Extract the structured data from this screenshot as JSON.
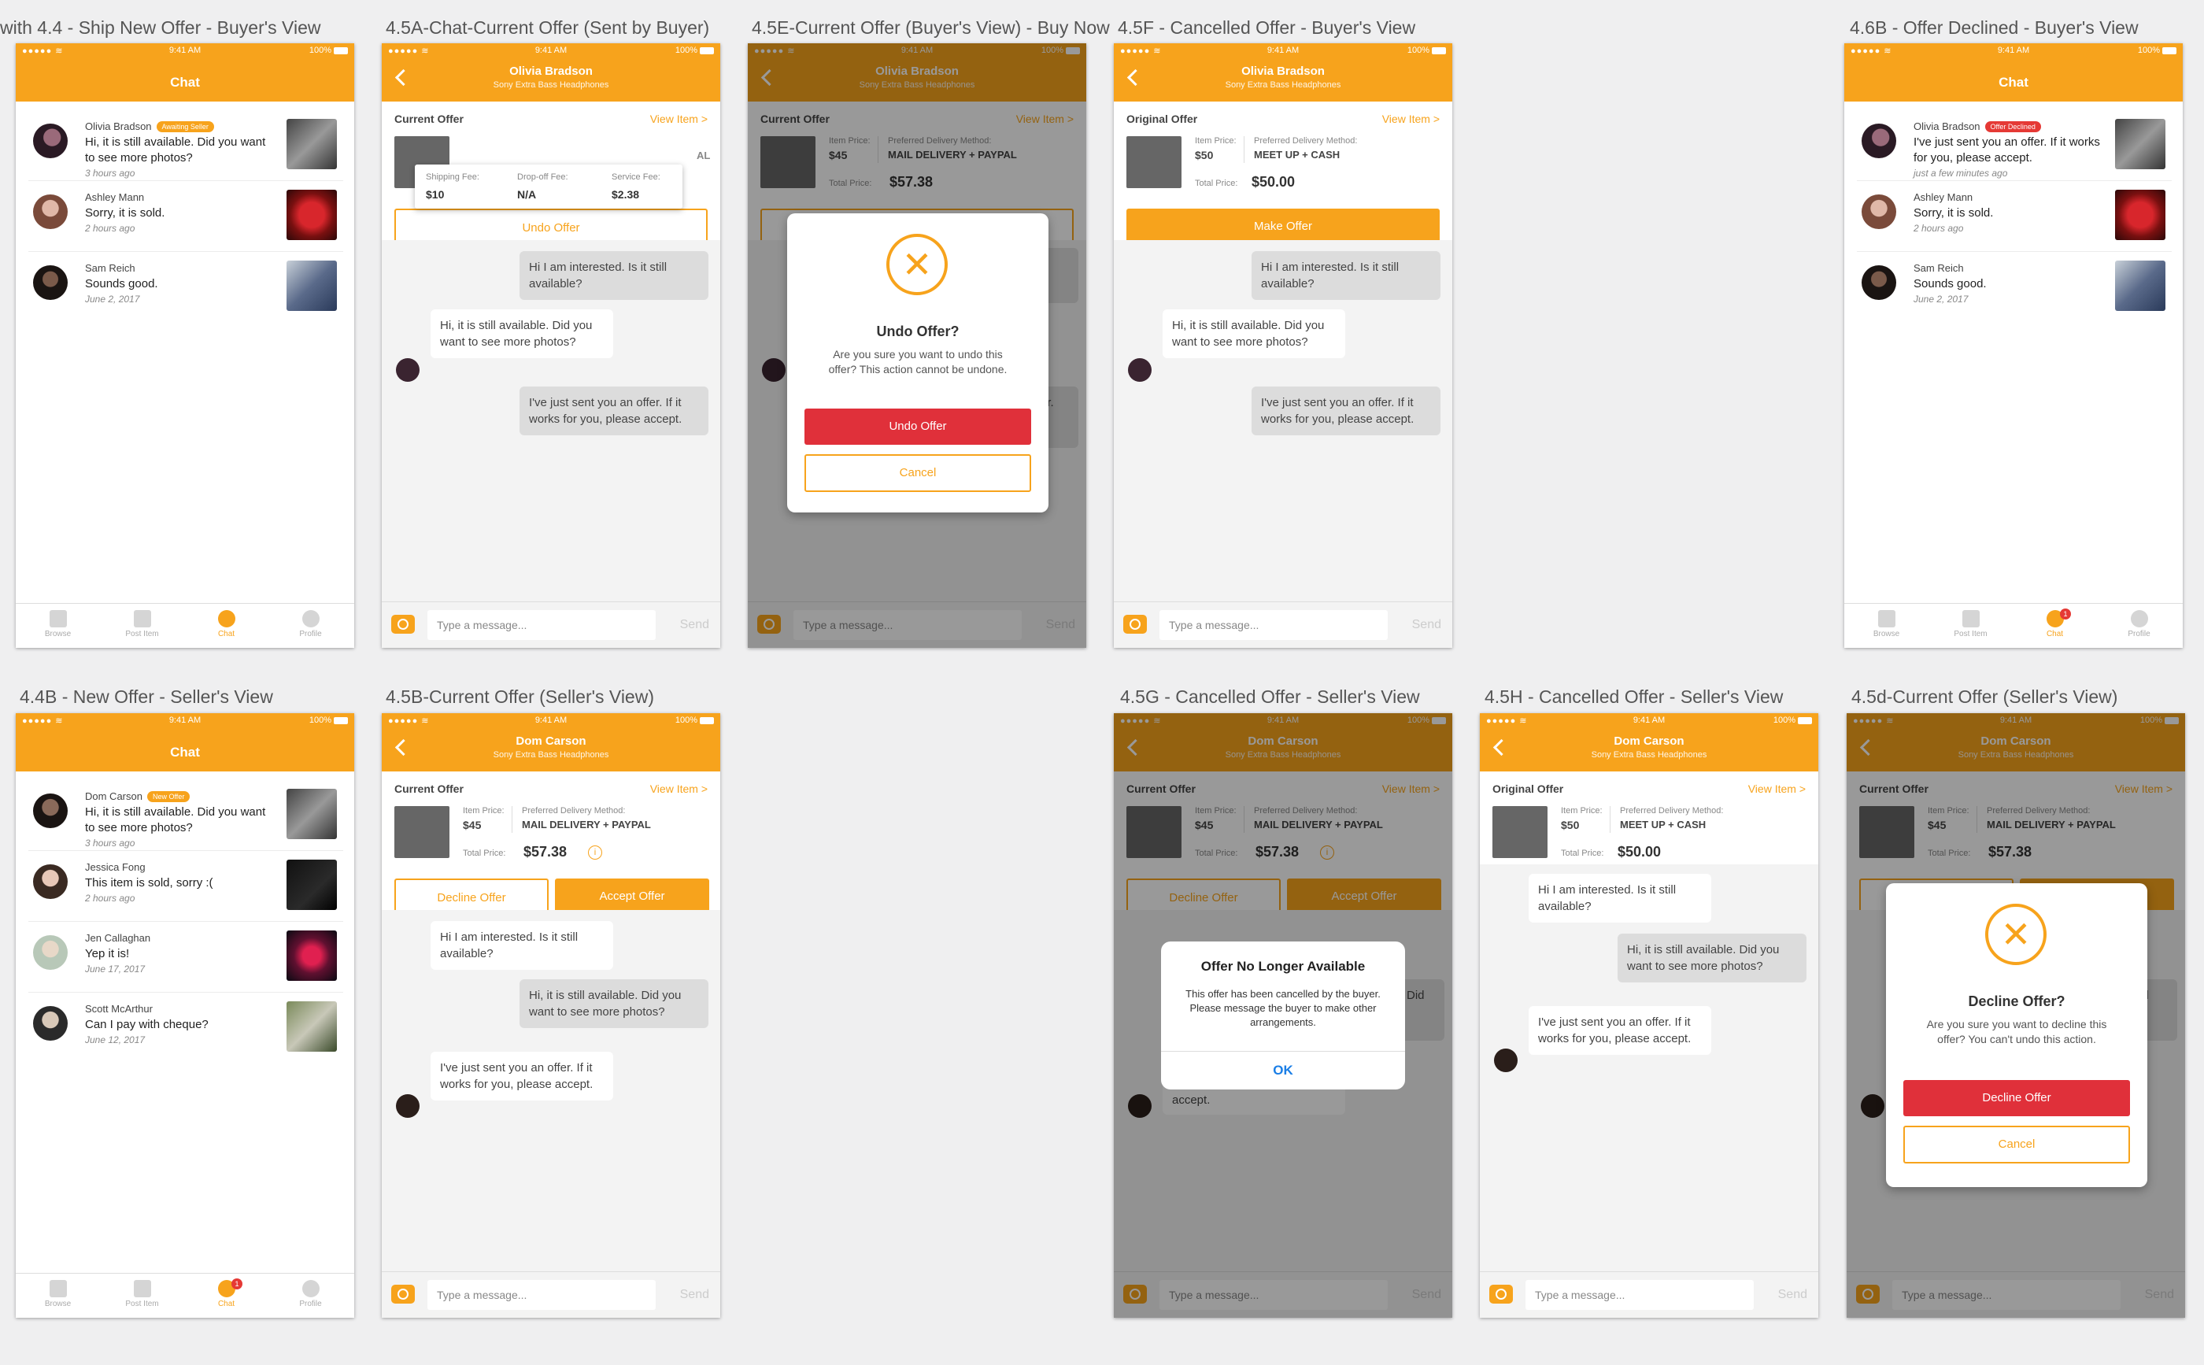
{
  "labels": {
    "l1": "with 4.4 - Ship New Offer - Buyer's View",
    "l2": "4.5A-Chat-Current Offer (Sent by Buyer)",
    "l3": "4.5E-Current Offer (Buyer's View) - Buy Now",
    "l4": "4.5F - Cancelled Offer - Buyer's View",
    "l5": "4.6B - Offer Declined - Buyer's View",
    "l6": "4.4B - New Offer - Seller's View",
    "l7": "4.5B-Current Offer (Seller's View)",
    "l8": "4.5G - Cancelled Offer - Seller's View",
    "l9": "4.5H - Cancelled Offer - Seller's View",
    "l10": "4.5d-Current Offer (Seller's View)"
  },
  "status": {
    "dots": "●●●●● ≋",
    "time": "9:41 AM",
    "battery": "100%"
  },
  "chat_title": "Chat",
  "product_sub": "Sony Extra Bass Headphones",
  "tabs": {
    "browse": "Browse",
    "post": "Post Item",
    "chat": "Chat",
    "profile": "Profile",
    "badge": "1"
  },
  "composer": {
    "placeholder": "Type a message...",
    "send": "Send"
  },
  "offer": {
    "current": "Current Offer",
    "original": "Original Offer",
    "view_item": "View Item >",
    "item_price_label": "Item Price:",
    "delivery_label": "Preferred Delivery Method:",
    "total_label": "Total Price:",
    "price_45": "$45",
    "price_50": "$50",
    "mail": "MAIL DELIVERY + PAYPAL",
    "meetup": "MEET UP + CASH",
    "total_57": "$57.38",
    "total_50": "$50.00",
    "info": "i"
  },
  "buttons": {
    "undo": "Undo Offer",
    "make": "Make Offer",
    "decline": "Decline Offer",
    "accept": "Accept Offer",
    "cancel": "Cancel",
    "ok": "OK"
  },
  "fees": {
    "ship_l": "Shipping Fee:",
    "ship_v": "$10",
    "drop_l": "Drop-off Fee:",
    "drop_v": "N/A",
    "svc_l": "Service Fee:",
    "svc_v": "$2.38",
    "al": "AL"
  },
  "msgs": {
    "m1": "Hi I am interested. Is it still available?",
    "m2": "Hi, it is still available. Did you want to see more photos?",
    "m3": "I've just sent you an offer. If it works for you, please accept."
  },
  "modals": {
    "undo_title": "Undo Offer?",
    "undo_body": "Are you sure you want to undo this offer? This action cannot be undone.",
    "decline_title": "Decline Offer?",
    "decline_body": "Are you sure you want to decline this offer? You can't undo this action.",
    "x": "✕",
    "nla_title": "Offer No Longer Available",
    "nla_body": "This offer has been cancelled by the buyer. Please message the buyer to make other arrangements."
  },
  "partial": {
    "ee": "er.",
    "e": "e",
    "did": "Did",
    "d": "id",
    "works": "If it works for you, please accept."
  },
  "names": {
    "olivia": "Olivia Bradson",
    "dom": "Dom Carson"
  },
  "buyer_convos": [
    {
      "name": "Olivia Bradson",
      "badge": "Awaiting Seller",
      "msg": "Hi, it is still available. Did you want to see more photos?",
      "time": "3 hours ago"
    },
    {
      "name": "Ashley Mann",
      "msg": "Sorry, it is sold.",
      "time": "2 hours ago"
    },
    {
      "name": "Sam Reich",
      "msg": "Sounds good.",
      "time": "June 2, 2017"
    }
  ],
  "declined_convos": [
    {
      "name": "Olivia Bradson",
      "badge": "Offer Declined",
      "msg": "I've just sent you an offer. If it works for you, please accept.",
      "time": "just a few minutes ago"
    },
    {
      "name": "Ashley Mann",
      "msg": "Sorry, it is sold.",
      "time": "2 hours ago"
    },
    {
      "name": "Sam Reich",
      "msg": "Sounds good.",
      "time": "June 2, 2017"
    }
  ],
  "seller_convos": [
    {
      "name": "Dom Carson",
      "badge": "New Offer",
      "msg": "Hi, it is still available. Did you want to see more photos?",
      "time": "3 hours ago"
    },
    {
      "name": "Jessica Fong",
      "msg": "This item is sold, sorry :(",
      "time": "2 hours ago"
    },
    {
      "name": "Jen Callaghan",
      "msg": "Yep it is!",
      "time": "June 17, 2017"
    },
    {
      "name": "Scott McArthur",
      "msg": "Can I pay with cheque?",
      "time": "June 12, 2017"
    }
  ],
  "colors": {
    "accent": "#f7a31c",
    "danger": "#e0303a",
    "badge_red": "#e53935",
    "link": "#1a7ee6"
  }
}
